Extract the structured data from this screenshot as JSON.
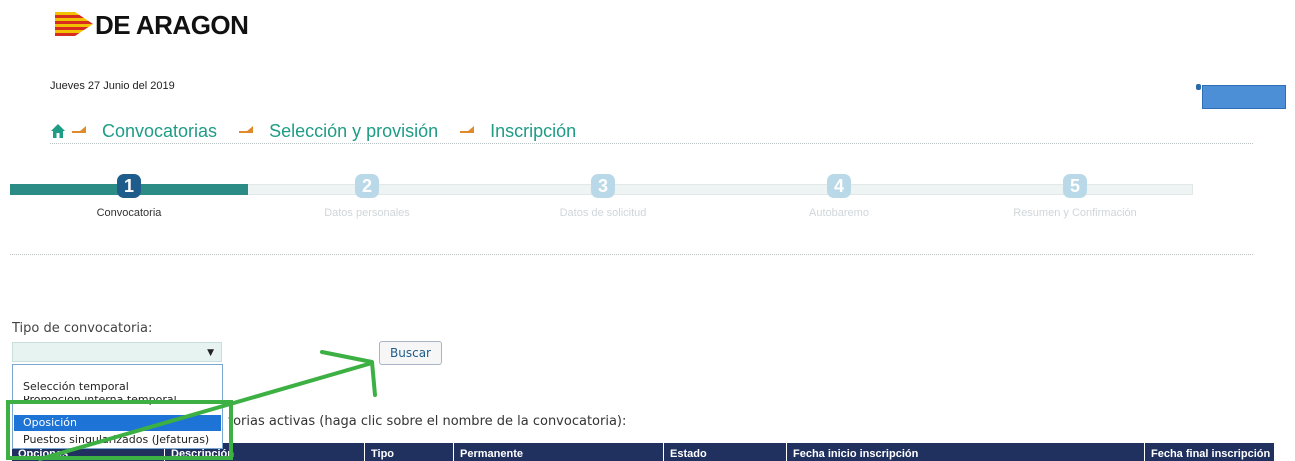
{
  "header": {
    "logo_text": "DE ARAGON",
    "date": "Jueves 27 Junio del 2019"
  },
  "breadcrumb": {
    "items": [
      "Convocatorias",
      "Selección y provisión",
      "Inscripción"
    ]
  },
  "steps": [
    {
      "number": "1",
      "label": "Convocatoria",
      "active": true
    },
    {
      "number": "2",
      "label": "Datos personales",
      "active": false
    },
    {
      "number": "3",
      "label": "Datos de solicitud",
      "active": false
    },
    {
      "number": "4",
      "label": "Autobaremo",
      "active": false
    },
    {
      "number": "5",
      "label": "Resumen y Confirmación",
      "active": false
    }
  ],
  "form": {
    "tipo_label": "Tipo de convocatoria:",
    "select_value": "",
    "search_button": "Buscar",
    "options": [
      "Selección temporal",
      "Promoción interna temporal",
      "Oposición",
      "Puestos singularizados (Jefaturas)"
    ],
    "selected_option": "Oposición"
  },
  "list_label": "torias activas (haga clic sobre el nombre de la convocatoria):",
  "table": {
    "columns": [
      "Opciones",
      "Descripción",
      "Tipo",
      "Permanente",
      "Estado",
      "Fecha inicio inscripción",
      "Fecha final inscripción"
    ]
  },
  "colors": {
    "accent_teal": "#1e9c86",
    "step_active": "#1e5c8c",
    "table_header": "#20315f",
    "annotation_green": "#3cb043",
    "selected_option": "#1e73d6"
  }
}
